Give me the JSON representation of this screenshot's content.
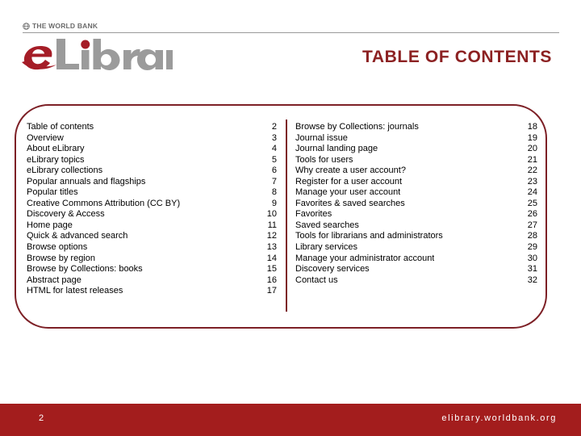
{
  "header": {
    "organization": "THE WORLD BANK",
    "logo_e": "e",
    "logo_library": "Library",
    "title": "TABLE OF CONTENTS",
    "brand_red": "#8c2122",
    "logo_gray": "#9b9b9b"
  },
  "toc": {
    "left_column": [
      {
        "label": "Table of contents",
        "page": "2"
      },
      {
        "label": "Overview",
        "page": "3"
      },
      {
        "label": "About eLibrary",
        "page": "4"
      },
      {
        "label": "eLibrary topics",
        "page": "5"
      },
      {
        "label": "eLibrary collections",
        "page": "6"
      },
      {
        "label": "Popular annuals and flagships",
        "page": "7"
      },
      {
        "label": "Popular titles",
        "page": "8"
      },
      {
        "label": "Creative Commons Attribution (CC BY)",
        "page": "9"
      },
      {
        "label": "Discovery & Access",
        "page": "10"
      },
      {
        "label": "Home page",
        "page": "11"
      },
      {
        "label": "Quick & advanced search",
        "page": "12"
      },
      {
        "label": "Browse options",
        "page": "13"
      },
      {
        "label": "Browse by region",
        "page": "14"
      },
      {
        "label": "Browse by Collections: books",
        "page": "15"
      },
      {
        "label": "Abstract page",
        "page": "16"
      },
      {
        "label": "HTML for latest releases",
        "page": "17"
      }
    ],
    "right_column": [
      {
        "label": "Browse by Collections: journals",
        "page": "18"
      },
      {
        "label": "Journal issue",
        "page": "19"
      },
      {
        "label": "Journal landing page",
        "page": "20"
      },
      {
        "label": "Tools for users",
        "page": "21"
      },
      {
        "label": "Why create a user account?",
        "page": "22"
      },
      {
        "label": "Register for a user account",
        "page": "23"
      },
      {
        "label": "Manage your user account",
        "page": "24"
      },
      {
        "label": "Favorites & saved searches",
        "page": "25"
      },
      {
        "label": "Favorites",
        "page": "26"
      },
      {
        "label": "Saved searches",
        "page": "27"
      },
      {
        "label": "Tools for librarians and administrators",
        "page": "28"
      },
      {
        "label": "Library services",
        "page": "29"
      },
      {
        "label": "Manage your administrator account",
        "page": "30"
      },
      {
        "label": "Discovery services",
        "page": "31"
      },
      {
        "label": "Contact us",
        "page": "32"
      }
    ],
    "border_color": "#7d2026"
  },
  "footer": {
    "page_number": "2",
    "url": "elibrary.worldbank.org",
    "bar_color": "#a31d1d"
  }
}
